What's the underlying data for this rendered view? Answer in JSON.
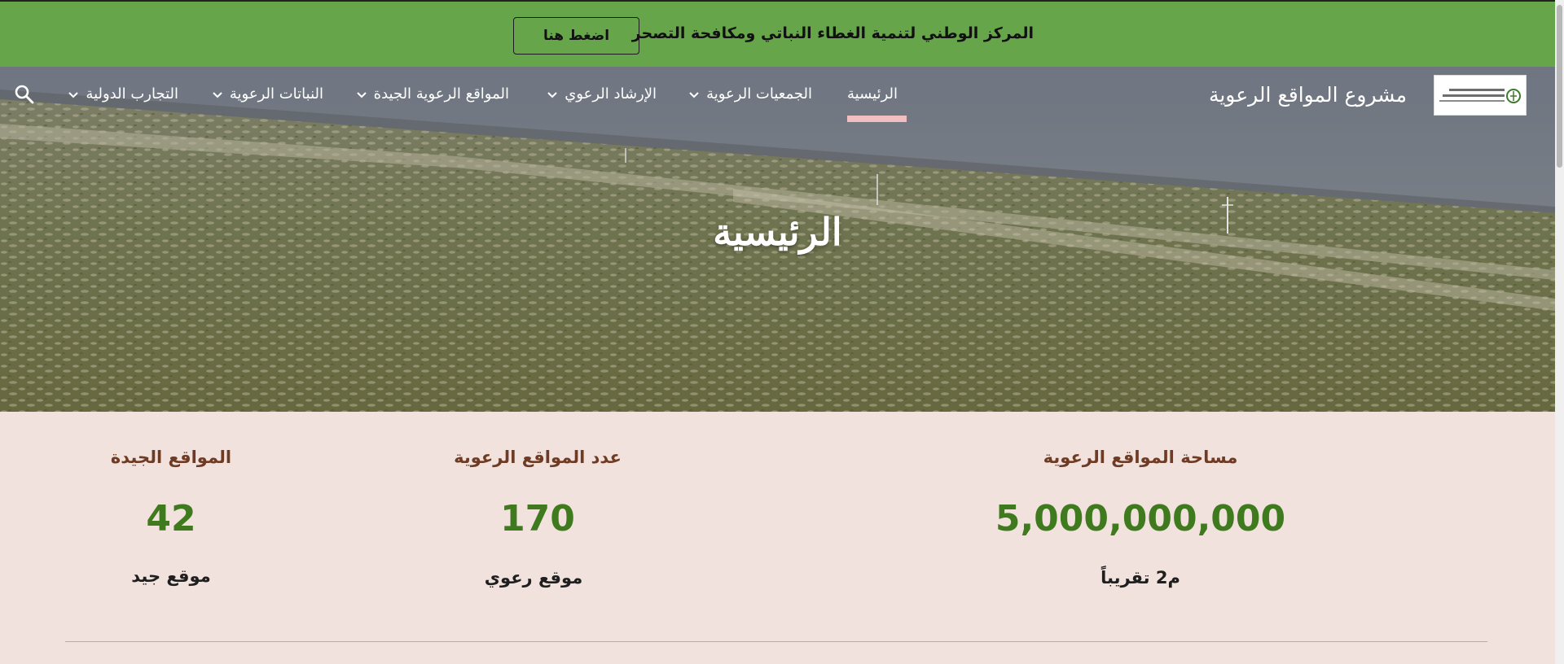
{
  "topbar": {
    "text": "المركز الوطني لتنمية الغطاء النباتي ومكافحة التصحر",
    "button_label": "اضغط هنا",
    "bg_color": "#66a54a"
  },
  "header": {
    "site_title": "مشروع المواقع الرعوية",
    "logo_line1": "المركز الوطني",
    "logo_line2": "لتنمية الغطاء النباتي ومكافحة التصحر",
    "nav": [
      {
        "label": "الرئيسية",
        "active": true
      },
      {
        "label": "الجمعيات الرعوية"
      },
      {
        "label": "الإرشاد الرعوي"
      },
      {
        "label": "المواقع الرعوية الجيدة"
      },
      {
        "label": "النباتات الرعوية"
      },
      {
        "label": "التجارب الدولية"
      }
    ],
    "search_icon": "search-icon",
    "chevron_icon": "chevron-down-icon",
    "active_color": "#f1bfbf"
  },
  "hero": {
    "title": "الرئيسية"
  },
  "stats": [
    {
      "heading": "مساحة المواقع الرعوية",
      "value": "5,000,000,000",
      "unit": "م2 تقريباً"
    },
    {
      "heading": "عدد المواقع الرعوية",
      "value": "170",
      "unit": "موقع رعوي"
    },
    {
      "heading": "المواقع الجيدة",
      "value": "42",
      "unit": "موقع جيد"
    }
  ],
  "colors": {
    "stat_heading": "#6e3b24",
    "stat_number": "#3f7a1f",
    "section_bg": "#f2e2dd"
  }
}
